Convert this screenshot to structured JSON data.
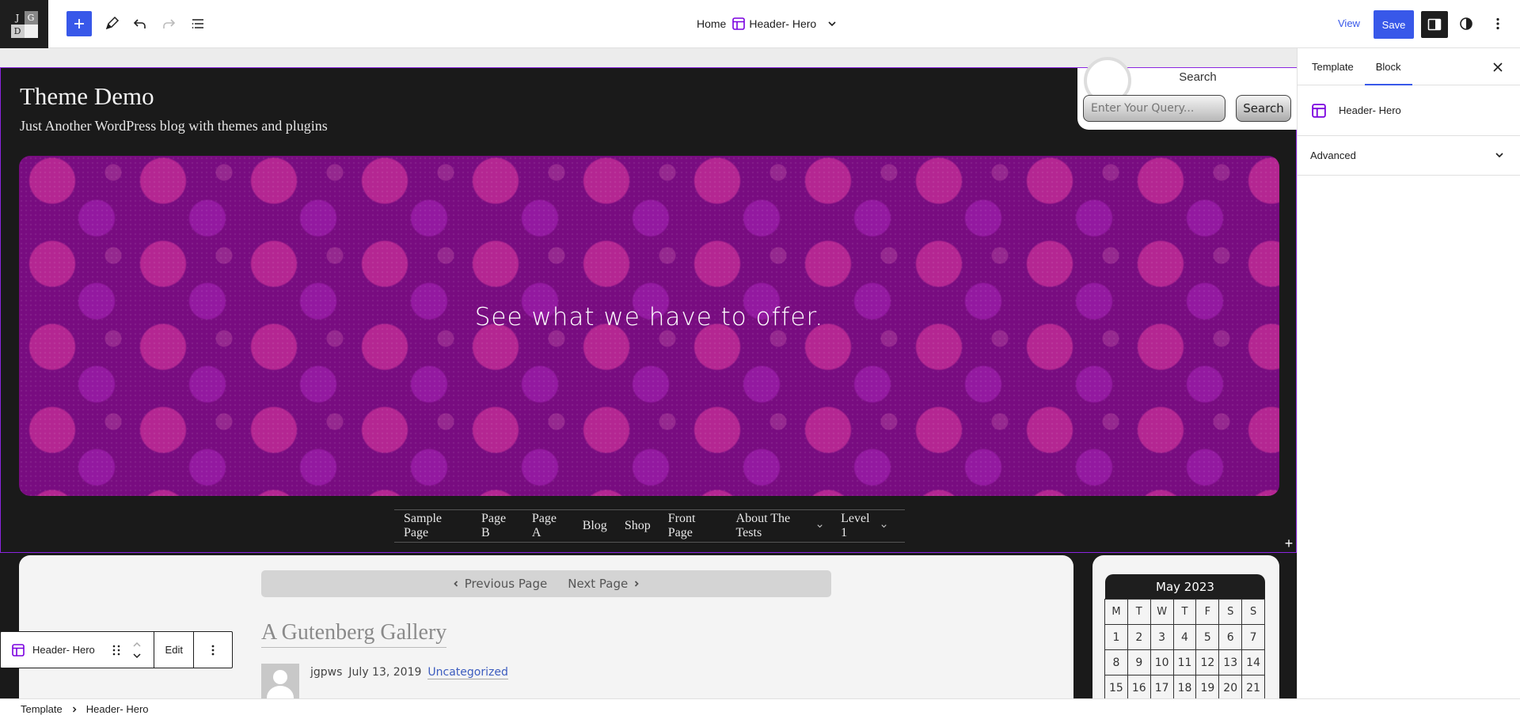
{
  "app": {
    "logo_letters": [
      "J",
      "G",
      "D",
      ""
    ]
  },
  "toolbar": {
    "breadcrumb_home": "Home",
    "template_name": "Header- Hero",
    "view_label": "View",
    "save_label": "Save"
  },
  "site": {
    "title": "Theme Demo",
    "tagline": "Just Another WordPress blog with themes and plugins"
  },
  "search": {
    "label": "Search",
    "placeholder": "Enter Your Query...",
    "button_label": "Search"
  },
  "hero": {
    "text": "See what we have to offer.",
    "color": "#780c80"
  },
  "nav": {
    "items": [
      {
        "label": "Sample Page"
      },
      {
        "label": "Page B"
      },
      {
        "label": "Page A"
      },
      {
        "label": "Blog"
      },
      {
        "label": "Shop"
      },
      {
        "label": "Front Page"
      },
      {
        "label": "About The Tests"
      },
      {
        "label": "Level 1"
      }
    ]
  },
  "pager": {
    "previous_label": "Previous Page",
    "next_label": "Next Page"
  },
  "post": {
    "title": "A Gutenberg Gallery",
    "author": "jgpws",
    "date": "July 13, 2019",
    "category": "Uncategorized"
  },
  "calendar": {
    "month": "May 2023",
    "weekdays": [
      "M",
      "T",
      "W",
      "T",
      "F",
      "S",
      "S"
    ],
    "days": [
      "1",
      "2",
      "3",
      "4",
      "5",
      "6",
      "7",
      "8",
      "9",
      "10",
      "11",
      "12",
      "13",
      "14",
      "15",
      "16",
      "17",
      "18",
      "19",
      "20",
      "21"
    ]
  },
  "block_toolbar": {
    "block_name": "Header- Hero",
    "edit_label": "Edit"
  },
  "settings": {
    "tabs": [
      "Template",
      "Block"
    ],
    "active_tab": "Block",
    "block_name": "Header- Hero",
    "advanced_label": "Advanced"
  },
  "footer": {
    "crumbs": [
      "Template",
      "Header- Hero"
    ]
  },
  "colors": {
    "accent": "#3858e9",
    "selection": "#8a24e0",
    "template_icon": "#7a00df"
  }
}
